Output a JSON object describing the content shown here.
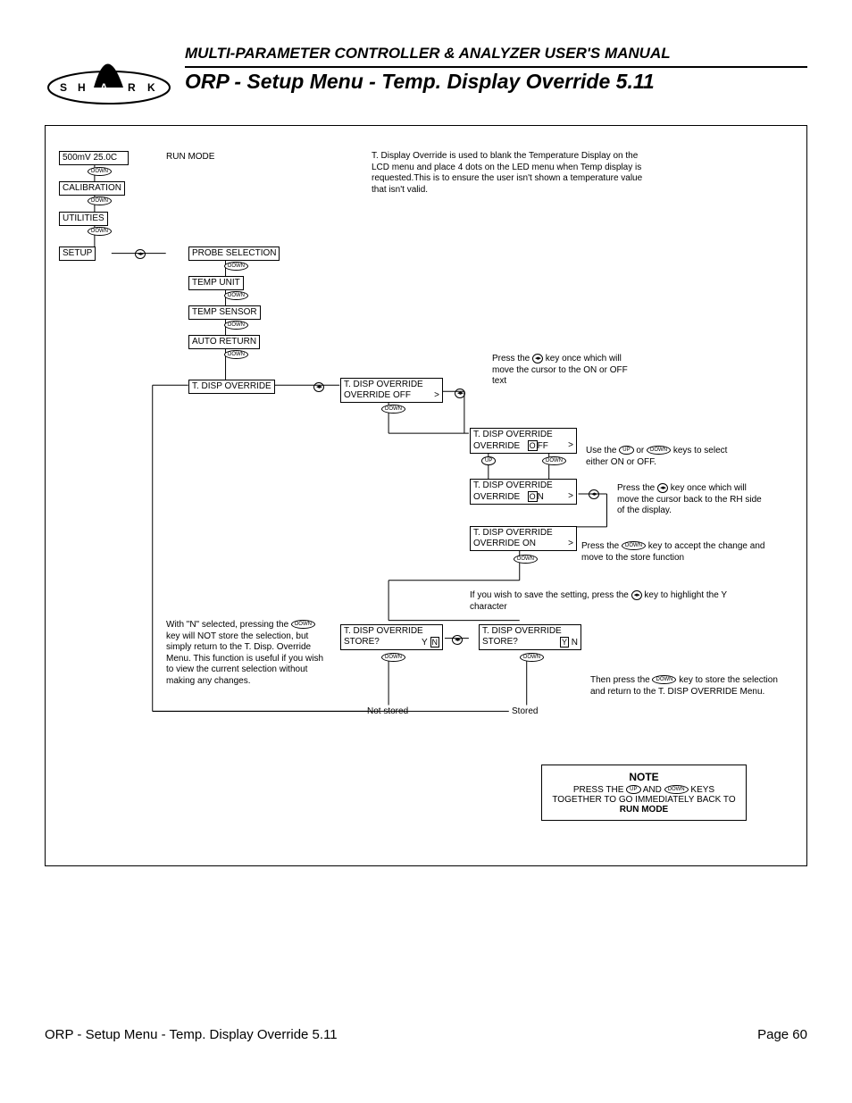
{
  "header": {
    "manual_title": "MULTI-PARAMETER CONTROLLER & ANALYZER USER'S MANUAL",
    "page_title": "ORP - Setup Menu - Temp. Display Override 5.11"
  },
  "menu": {
    "run_display": "500mV  25.0C",
    "run_mode": "RUN MODE",
    "calibration": "CALIBRATION",
    "utilities": "UTILITIES",
    "setup": "SETUP",
    "probe_selection": "PROBE SELECTION",
    "temp_unit": "TEMP UNIT",
    "temp_sensor": "TEMP SENSOR",
    "auto_return": "AUTO RETURN",
    "t_disp_override": "T. DISP OVERRIDE"
  },
  "screens": {
    "override_off_initial_l1": "T. DISP OVERRIDE",
    "override_off_initial_l2": "OVERRIDE   OFF",
    "override_off_cursor_l1": "T. DISP OVERRIDE",
    "override_off_cursor_l2": "OVERRIDE",
    "off_label": "OFF",
    "override_on_cursor_l1": "T. DISP OVERRIDE",
    "override_on_cursor_l2": "OVERRIDE",
    "on_label": "ON",
    "override_on_final_l1": "T. DISP OVERRIDE",
    "override_on_final_l2": "OVERRIDE     ON",
    "store_l1": "T. DISP OVERRIDE",
    "store_l2": "STORE?",
    "store_yn_n": "Y  N",
    "store_yn_y": "Y  N",
    "not_stored": "Not stored",
    "stored": "Stored"
  },
  "descriptions": {
    "main": "T. Display Override is used to blank the Temperature Display on the LCD menu and place 4 dots on the LED menu when Temp display is requested.This is to ensure the user isn't shown a temperature value that isn't valid.",
    "press_lr_once": "Press the           key once which will move the cursor to the ON or OFF text",
    "use_up_down": "Use the           or            keys to select either ON or OFF.",
    "press_lr_back": "Press the           key once which will move the cursor back to the RH side of the display.",
    "press_down_accept": "Press the            key to accept the change and move to the store function",
    "save_setting": "If you wish to save the setting, press the key to highlight the Y character",
    "n_selected": "With \"N\" selected, pressing the            key will NOT store the selection, but simply return to the T. Disp. Override Menu. This function is useful if you wish to view the current selection without making any changes.",
    "then_down": "Then press the            key to store the selection and return to the T. DISP OVERRIDE Menu."
  },
  "keys": {
    "down": "DOWN",
    "up": "UP",
    "lr": "◂ ▸"
  },
  "note": {
    "title": "NOTE",
    "line1_a": "PRESS THE",
    "line1_b": "AND",
    "line1_c": "KEYS",
    "line2": "TOGETHER TO GO IMMEDIATELY BACK TO",
    "line3": "RUN MODE"
  },
  "footer": {
    "left": "ORP - Setup Menu - Temp. Display Override 5.11",
    "right": "Page 60"
  }
}
